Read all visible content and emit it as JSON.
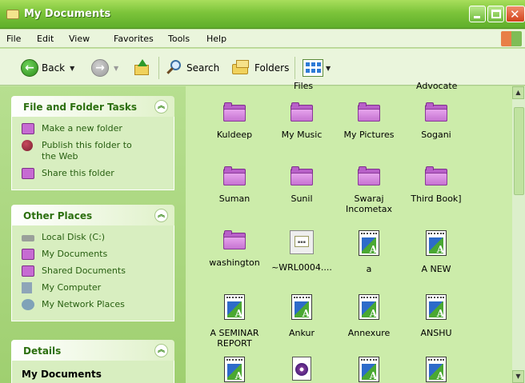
{
  "window": {
    "title": "My Documents"
  },
  "menu": [
    "File",
    "Edit",
    "View",
    "Favorites",
    "Tools",
    "Help"
  ],
  "toolbar": {
    "back": "Back",
    "search": "Search",
    "folders": "Folders"
  },
  "tasks_panel": {
    "title": "File and Folder Tasks",
    "items": [
      "Make a new folder",
      "Publish this folder to the Web",
      "Share this folder"
    ]
  },
  "places_panel": {
    "title": "Other Places",
    "items": [
      "Local Disk (C:)",
      "My Documents",
      "Shared Documents",
      "My Computer",
      "My Network Places"
    ]
  },
  "details_panel": {
    "title": "Details",
    "name": "My Documents"
  },
  "cut_labels": [
    "Files",
    "Advocate"
  ],
  "files": [
    {
      "name": "Kuldeep",
      "type": "folder"
    },
    {
      "name": "My Music",
      "type": "folder"
    },
    {
      "name": "My Pictures",
      "type": "folder"
    },
    {
      "name": "Sogani",
      "type": "folder"
    },
    {
      "name": "Suman",
      "type": "folder"
    },
    {
      "name": "Sunil",
      "type": "folder"
    },
    {
      "name": "Swaraj Incometax",
      "type": "folder"
    },
    {
      "name": "Third Book]",
      "type": "folder"
    },
    {
      "name": "washington",
      "type": "folder"
    },
    {
      "name": "~WRL0004....",
      "type": "tmp"
    },
    {
      "name": "a",
      "type": "word"
    },
    {
      "name": "A NEW",
      "type": "word"
    },
    {
      "name": "A SEMINAR REPORT",
      "type": "word"
    },
    {
      "name": "Ankur",
      "type": "word"
    },
    {
      "name": "Annexure",
      "type": "word"
    },
    {
      "name": "ANSHU",
      "type": "word"
    },
    {
      "name": "",
      "type": "word"
    },
    {
      "name": "",
      "type": "media"
    },
    {
      "name": "",
      "type": "word"
    },
    {
      "name": "",
      "type": "word"
    }
  ]
}
